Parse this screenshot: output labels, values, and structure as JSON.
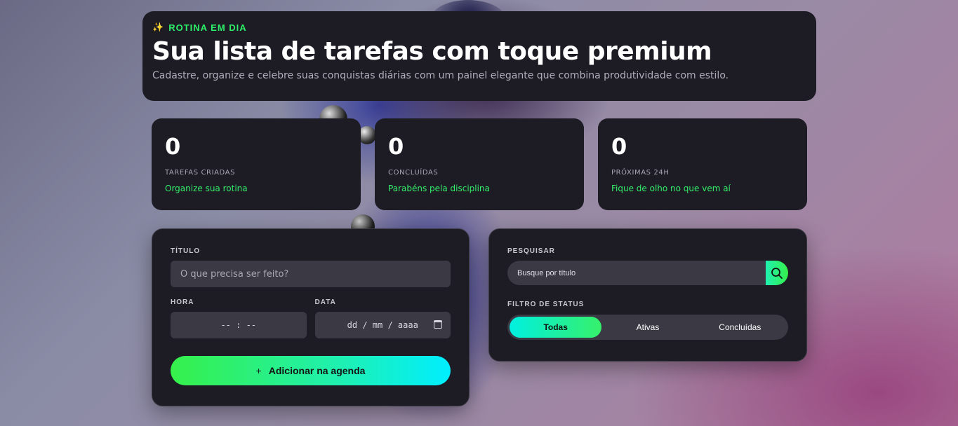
{
  "hero": {
    "eyebrow_icon": "sparkles-icon",
    "eyebrow": "ROTINA EM DIA",
    "title": "Sua lista de tarefas com toque premium",
    "subtitle": "Cadastre, organize e celebre suas conquistas diárias com um painel elegante que combina produtividade com estilo."
  },
  "stats": [
    {
      "value": "0",
      "label": "TAREFAS CRIADAS",
      "note": "Organize sua rotina"
    },
    {
      "value": "0",
      "label": "CONCLUÍDAS",
      "note": "Parabéns pela disciplina"
    },
    {
      "value": "0",
      "label": "PRÓXIMAS 24H",
      "note": "Fique de olho no que vem aí"
    }
  ],
  "form": {
    "title_label": "TÍTULO",
    "title_placeholder": "O que precisa ser feito?",
    "time_label": "HORA",
    "time_value": "-- : --",
    "date_label": "DATA",
    "date_value": "dd / mm / aaaa",
    "add_button": "Adicionar na agenda",
    "add_icon": "+"
  },
  "filters": {
    "search_label": "PESQUISAR",
    "search_placeholder": "Busque por título",
    "status_label": "FILTRO DE STATUS",
    "tabs": [
      {
        "label": "Todas",
        "active": true
      },
      {
        "label": "Ativas",
        "active": false
      },
      {
        "label": "Concluídas",
        "active": false
      }
    ]
  },
  "colors": {
    "accent_green": "#2ef06a",
    "accent_cyan": "#00eeff",
    "panel_bg": "#1d1c24"
  }
}
